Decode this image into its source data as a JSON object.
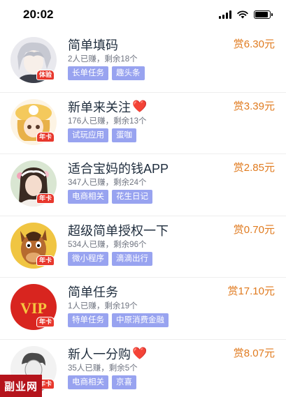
{
  "status": {
    "time": "20:02",
    "battery_level": 0.9
  },
  "tasks": [
    {
      "title": "简单填码",
      "heart": false,
      "stats": "2人已赚，剩余18个",
      "tags": [
        "长单任务",
        "趣头条"
      ],
      "reward": "赏6.30元",
      "badge": "体验",
      "avatar": "anime-gray-hair"
    },
    {
      "title": "新单来关注",
      "heart": true,
      "stats": "176人已赚，剩余13个",
      "tags": [
        "试玩应用",
        "蛋咖"
      ],
      "reward": "赏3.39元",
      "badge": "年卡",
      "avatar": "anime-girl-hat"
    },
    {
      "title": "适合宝妈的钱APP",
      "heart": false,
      "stats": "347人已赚，剩余24个",
      "tags": [
        "电商相关",
        "花生日记"
      ],
      "reward": "赏2.85元",
      "badge": "年卡",
      "avatar": "girl-flower-crown"
    },
    {
      "title": "超级简单授权一下",
      "heart": false,
      "stats": "534人已赚，剩余96个",
      "tags": [
        "微小程序",
        "滴滴出行"
      ],
      "reward": "赏0.70元",
      "badge": "年卡",
      "avatar": "cartoon-horse"
    },
    {
      "title": "简单任务",
      "heart": false,
      "stats": "1人已赚，剩余19个",
      "tags": [
        "特单任务",
        "中原消费金融"
      ],
      "reward": "赏17.10元",
      "badge": "年卡",
      "avatar": "vip-logo",
      "avatar_text": "VIP"
    },
    {
      "title": "新人一分购",
      "heart": true,
      "stats": "35人已赚，剩余5个",
      "tags": [
        "电商相关",
        "京喜"
      ],
      "reward": "赏8.07元",
      "badge": "年卡",
      "avatar": "sketch-person"
    }
  ],
  "heart_glyph": "❤️",
  "watermark": "副业网"
}
